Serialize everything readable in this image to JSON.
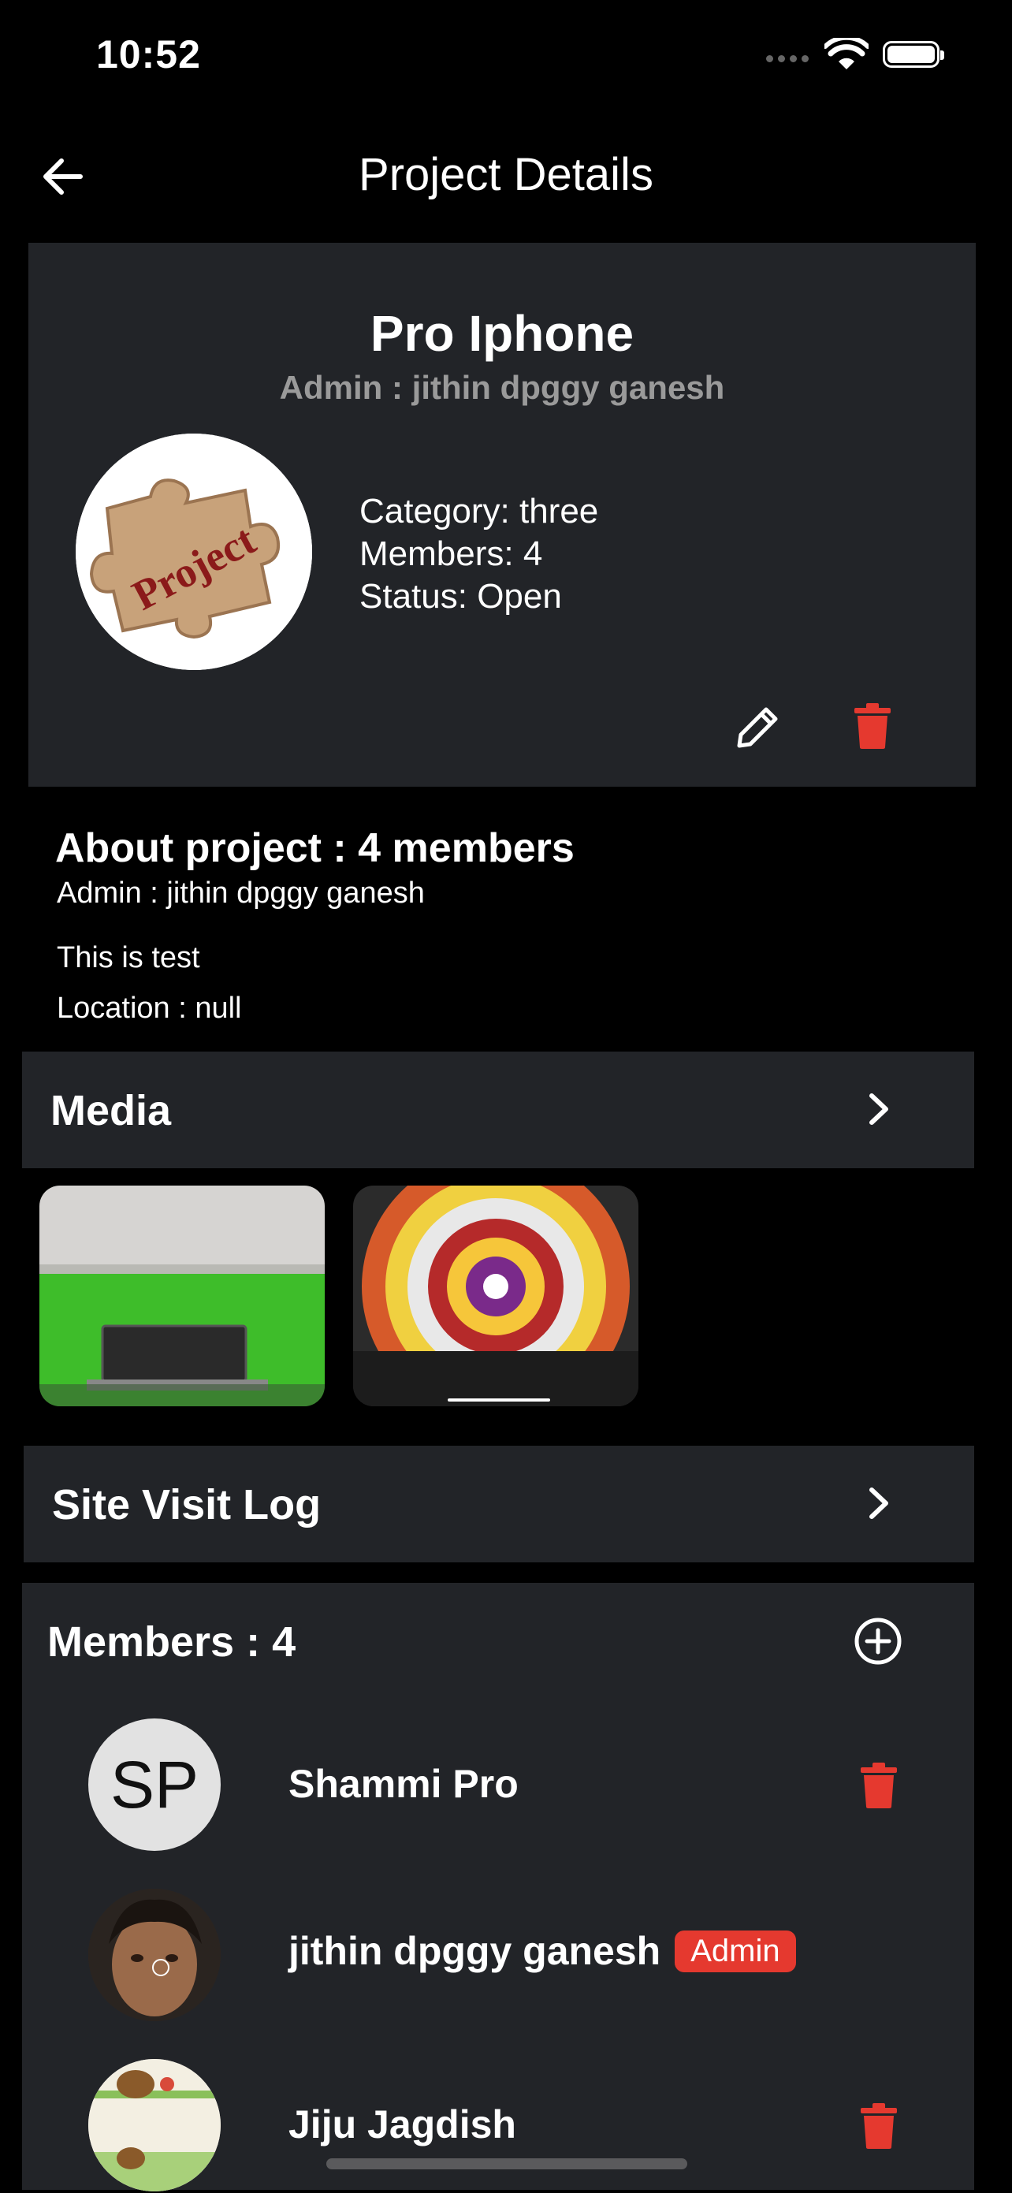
{
  "status_bar": {
    "time": "10:52"
  },
  "nav": {
    "title": "Project Details"
  },
  "project": {
    "name": "Pro Iphone",
    "admin_line": "Admin : jithin dpggy ganesh",
    "image_text": "Project",
    "category": "Category: three",
    "members": "Members: 4",
    "status": "Status: Open"
  },
  "about": {
    "title": "About project : 4 members",
    "admin": "Admin : jithin dpggy ganesh",
    "description": "This is test",
    "location": "Location : null"
  },
  "media": {
    "label": "Media"
  },
  "site_visit": {
    "label": "Site Visit Log"
  },
  "members_section": {
    "label": "Members : 4",
    "items": [
      {
        "name": "Shammi Pro",
        "initials": "SP",
        "badge": ""
      },
      {
        "name": "jithin dpggy ganesh",
        "initials": "",
        "badge": "Admin"
      },
      {
        "name": "Jiju Jagdish",
        "initials": "",
        "badge": ""
      }
    ]
  },
  "colors": {
    "card_bg": "#222428",
    "danger": "#e5392f",
    "text": "#ffffff",
    "muted": "#9a9a9a"
  },
  "icons": [
    "back-arrow-icon",
    "wifi-icon",
    "battery-icon",
    "edit-pencil-icon",
    "trash-icon",
    "chevron-right-icon",
    "add-circle-icon"
  ]
}
